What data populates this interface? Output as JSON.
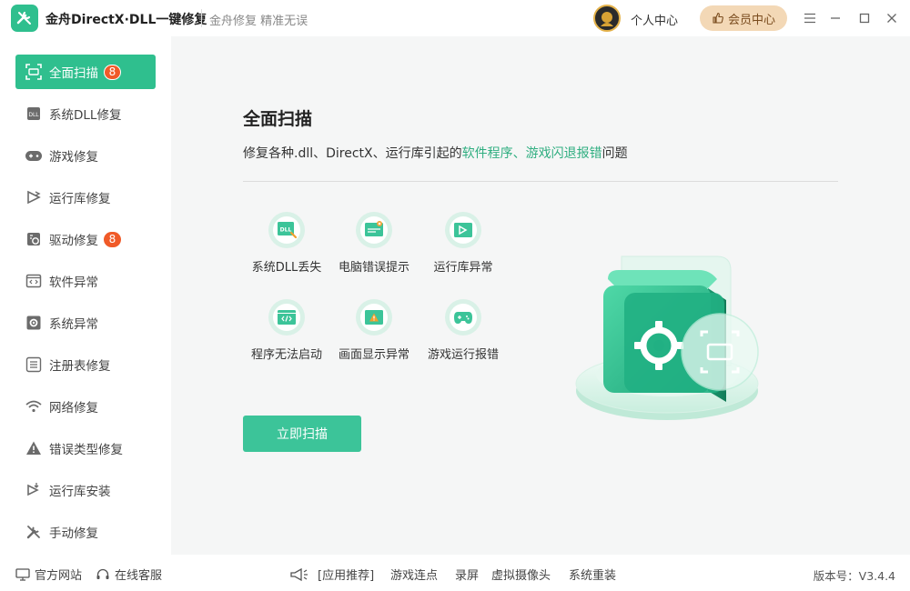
{
  "app": {
    "title": "金舟DirectX·DLL一键修复",
    "subtitle": "金舟修复 精准无误",
    "user_center": "个人中心",
    "vip_label": "会员中心"
  },
  "sidebar": {
    "items": [
      {
        "label": "全面扫描",
        "badge": "8",
        "icon": "scan-icon",
        "active": true
      },
      {
        "label": "系统DLL修复",
        "icon": "dll-icon"
      },
      {
        "label": "游戏修复",
        "icon": "gamepad-icon"
      },
      {
        "label": "运行库修复",
        "icon": "runtime-icon"
      },
      {
        "label": "驱动修复",
        "badge": "8",
        "icon": "driver-icon"
      },
      {
        "label": "软件异常",
        "icon": "code-icon"
      },
      {
        "label": "系统异常",
        "icon": "gear-icon"
      },
      {
        "label": "注册表修复",
        "icon": "list-icon"
      },
      {
        "label": "网络修复",
        "icon": "wifi-icon"
      },
      {
        "label": "错误类型修复",
        "icon": "warning-icon"
      },
      {
        "label": "运行库安装",
        "icon": "install-icon"
      },
      {
        "label": "手动修复",
        "icon": "wrench-icon"
      }
    ]
  },
  "main": {
    "title": "全面扫描",
    "desc_prefix": "修复各种.dll、DirectX、运行库引起的",
    "desc_highlight": "软件程序、游戏闪退报错",
    "desc_suffix": "问题",
    "features": [
      {
        "label": "系统DLL丢失",
        "icon": "dll-file-icon"
      },
      {
        "label": "电脑错误提示",
        "icon": "error-window-icon"
      },
      {
        "label": "运行库异常",
        "icon": "runtime-window-icon"
      },
      {
        "label": "程序无法启动",
        "icon": "code-window-icon"
      },
      {
        "label": "画面显示异常",
        "icon": "display-warning-icon"
      },
      {
        "label": "游戏运行报错",
        "icon": "game-controller-icon"
      }
    ],
    "scan_button": "立即扫描"
  },
  "footer": {
    "website": "官方网站",
    "support": "在线客服",
    "recommend": "[应用推荐]",
    "links": [
      "游戏连点",
      "录屏",
      "虚拟摄像头",
      "系统重装"
    ],
    "version": "版本号：V3.4.4"
  },
  "colors": {
    "accent": "#2fbf8e",
    "badge": "#f05a28",
    "highlight_text": "#2fae80",
    "vip_bg": "#f3d8b6"
  }
}
